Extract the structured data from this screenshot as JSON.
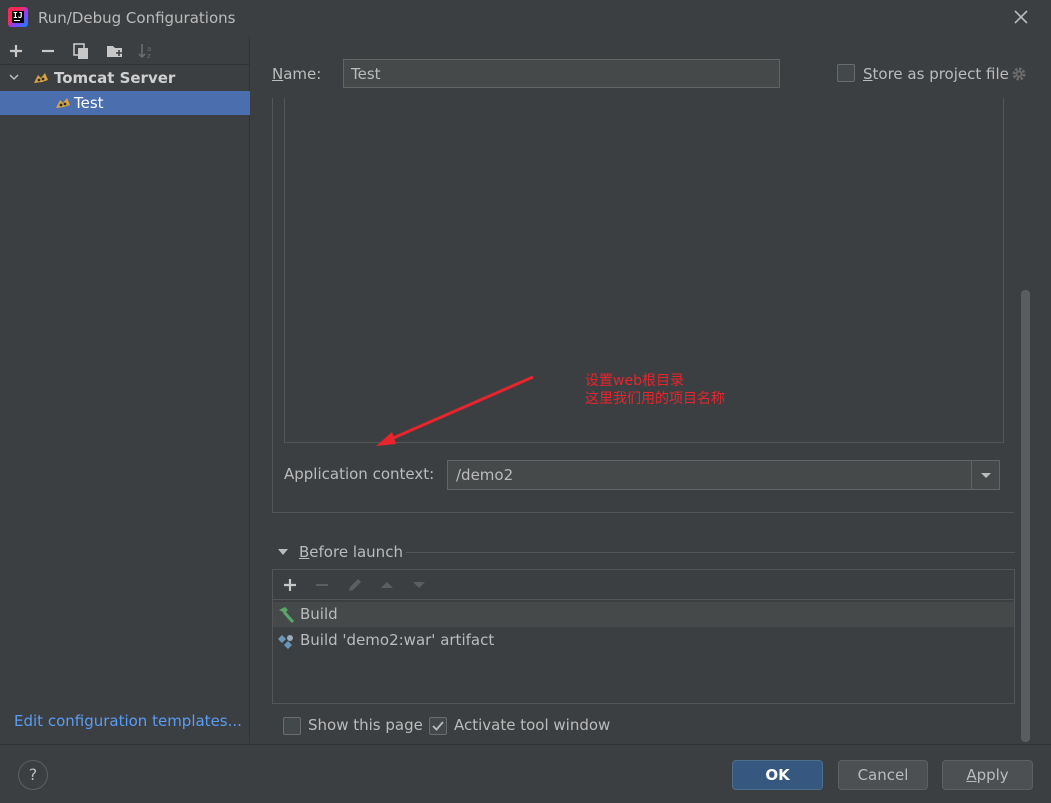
{
  "window": {
    "title": "Run/Debug Configurations"
  },
  "sidebar": {
    "group_label": "Tomcat Server",
    "selected_item": "Test",
    "templates_link": "Edit configuration templates..."
  },
  "form": {
    "name_label_u": "N",
    "name_label_rest": "ame:",
    "name_value": "Test",
    "store_label_u": "S",
    "store_label_rest": "tore as project file",
    "store_checked": false,
    "app_context_label": "Application context:",
    "app_context_value": "/demo2"
  },
  "annotation": {
    "line1": "设置web根目录",
    "line2": "这里我们用的项目名称",
    "color": "#e8242d"
  },
  "before_launch": {
    "label_u": "B",
    "label_rest": "efore launch",
    "tasks": [
      {
        "label": "Build",
        "icon": "hammer-icon"
      },
      {
        "label": "Build 'demo2:war' artifact",
        "icon": "artifact-icon"
      }
    ]
  },
  "options": {
    "show_page_label": "Show this page",
    "show_page_checked": false,
    "activate_label": "Activate tool window",
    "activate_checked": true
  },
  "buttons": {
    "ok": "OK",
    "cancel": "Cancel",
    "apply_u": "A",
    "apply_rest": "pply",
    "help": "?"
  },
  "colors": {
    "background": "#3c3f41",
    "selection": "#4b6eaf",
    "ok_button": "#365880",
    "link": "#589df6"
  }
}
